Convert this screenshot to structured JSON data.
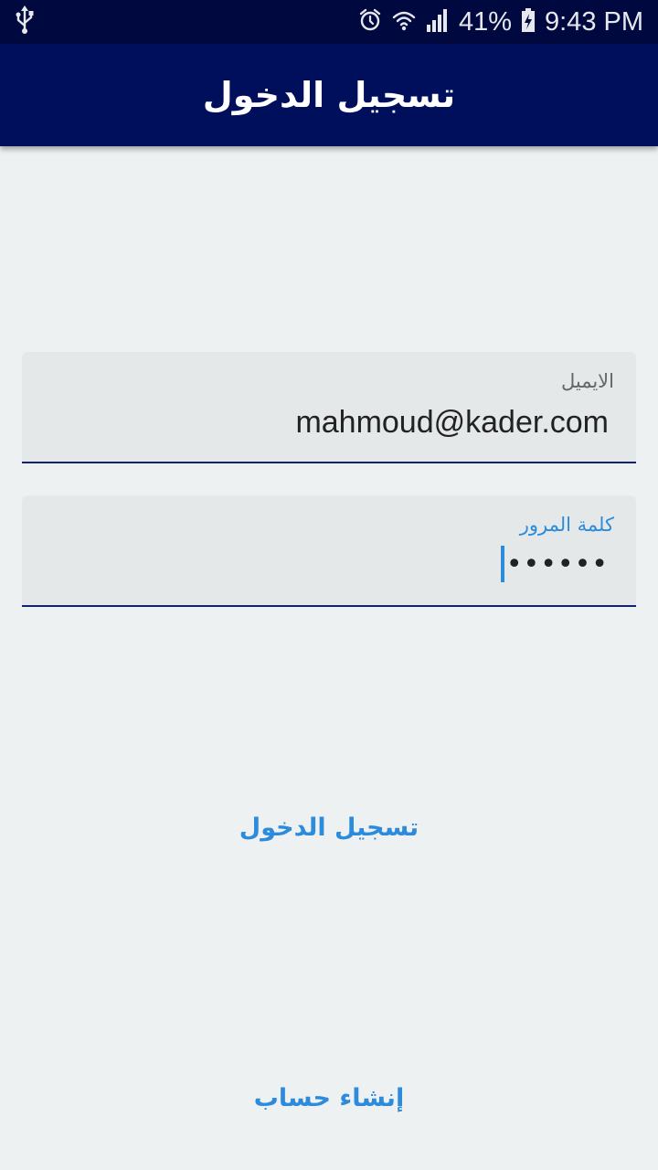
{
  "status_bar": {
    "battery": "41%",
    "time": "9:43 PM",
    "icons": [
      "usb-icon",
      "alarm-icon",
      "wifi-icon",
      "signal-icon",
      "battery-charging-icon"
    ]
  },
  "app_bar": {
    "title": "تسجيل الدخول"
  },
  "form": {
    "email": {
      "label": "الايميل",
      "value": "mahmoud@kader.com"
    },
    "password": {
      "label": "كلمة المرور",
      "masked_value": "••••••",
      "focused": true
    }
  },
  "actions": {
    "login_label": "تسجيل الدخول",
    "signup_label": "إنشاء حساب"
  },
  "colors": {
    "status_bar": "#00093f",
    "app_bar": "#000f5c",
    "background": "#eef1f1",
    "field_bg": "#e4e8e8",
    "accent": "#2d8bdc",
    "underline": "#142070"
  }
}
